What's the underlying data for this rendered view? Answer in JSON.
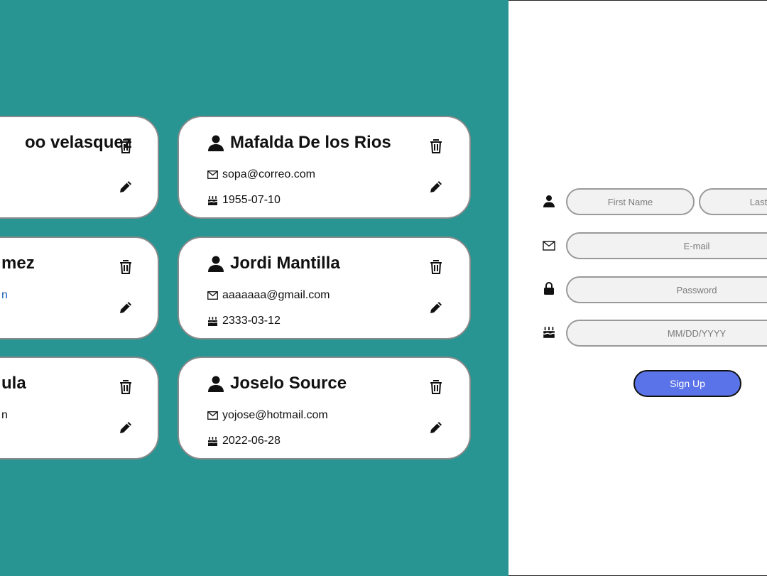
{
  "cards_left": [
    {
      "name": "oo velasquez",
      "email": "",
      "birthday": ""
    },
    {
      "name": "mez",
      "email": "n",
      "birthday": ""
    },
    {
      "name": "ula",
      "email": "n",
      "birthday": ""
    }
  ],
  "cards_right": [
    {
      "name": "Mafalda De los Rios",
      "email": "sopa@correo.com",
      "birthday": "1955-07-10"
    },
    {
      "name": "Jordi Mantilla",
      "email": "aaaaaaa@gmail.com",
      "birthday": "2333-03-12"
    },
    {
      "name": "Joselo Source",
      "email": "yojose@hotmail.com",
      "birthday": "2022-06-28"
    }
  ],
  "form": {
    "first_name_placeholder": "First Name",
    "last_name_placeholder": "Last N",
    "email_placeholder": "E-mail",
    "password_placeholder": "Password",
    "date_placeholder": "MM/DD/YYYY",
    "signup_label": "Sign Up"
  },
  "colors": {
    "panel_bg": "#289593",
    "button_bg": "#5b73e8",
    "input_bg": "#f2f2f2"
  }
}
